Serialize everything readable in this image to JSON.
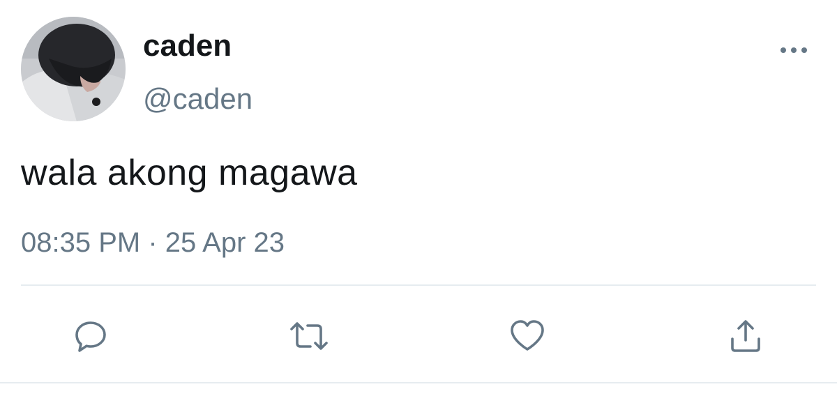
{
  "user": {
    "display_name": "caden",
    "handle": "@caden",
    "avatar_icon": "profile-photo"
  },
  "tweet": {
    "text": "wala akong magawa",
    "timestamp": "08:35 PM · 25 Apr 23"
  },
  "actions": {
    "reply_icon": "reply-icon",
    "retweet_icon": "retweet-icon",
    "like_icon": "like-icon",
    "share_icon": "share-icon",
    "more_icon": "more-icon"
  },
  "colors": {
    "text_primary": "#14171a",
    "text_secondary": "#657786",
    "icon_color": "#657786",
    "divider": "#e6ecf0"
  }
}
